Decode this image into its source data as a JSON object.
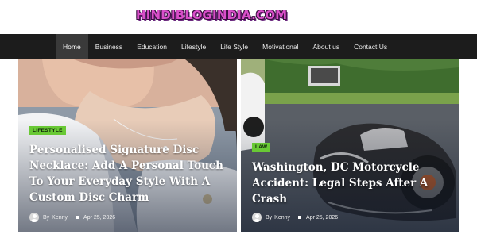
{
  "site": {
    "logo_text": "HINDIBLOGINDIA.COM"
  },
  "nav": {
    "items": [
      {
        "label": "Home",
        "active": true
      },
      {
        "label": "Business",
        "active": false
      },
      {
        "label": "Education",
        "active": false
      },
      {
        "label": "Lifestyle",
        "active": false
      },
      {
        "label": "Life Style",
        "active": false
      },
      {
        "label": "Motivational",
        "active": false
      },
      {
        "label": "About us",
        "active": false
      },
      {
        "label": "Contact Us",
        "active": false
      }
    ]
  },
  "posts": [
    {
      "category": "LIFESTYLE",
      "title": "Personalised Signature Disc Necklace: Add A Personal Touch To Your Everyday Style With A Custom Disc Charm",
      "by": "By",
      "author": "Kenny",
      "date": "Apr 25, 2026",
      "image": "woman-necklace-photo"
    },
    {
      "category": "LAW",
      "title": "Washington, DC Motorcycle Accident: Legal Steps After A Crash",
      "by": "By",
      "author": "Kenny",
      "date": "Apr 25, 2026",
      "image": "motorcycle-crash-photo"
    }
  ],
  "colors": {
    "navbar": "#1c1c1c",
    "badge": "#69c935",
    "logo": "#d94fc9"
  }
}
